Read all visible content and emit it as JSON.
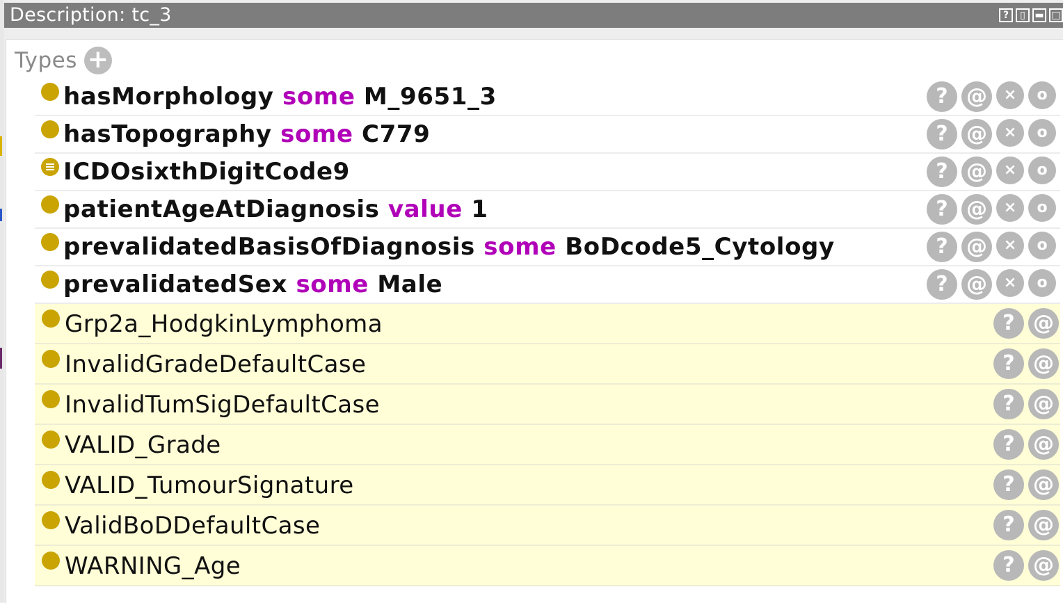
{
  "window": {
    "title": "Description: tc_3",
    "controls": [
      {
        "name": "help-icon",
        "glyph": "?"
      },
      {
        "name": "split-vertical-icon",
        "glyph": "▯"
      },
      {
        "name": "minimize-icon",
        "glyph": "▬"
      },
      {
        "name": "maximize-icon",
        "glyph": "□"
      }
    ]
  },
  "types": {
    "label": "Types",
    "add_glyph": "+",
    "asserted": [
      {
        "prop": "hasMorphology",
        "kw": "some",
        "filler": "M_9651_3",
        "dot": "class-icon"
      },
      {
        "prop": "hasTopography",
        "kw": "some",
        "filler": "C779",
        "dot": "class-icon"
      },
      {
        "prop": "ICDOsixthDigitCode9",
        "kw": "",
        "filler": "",
        "dot": "defined-class-icon"
      },
      {
        "prop": "patientAgeAtDiagnosis",
        "kw": "value",
        "filler": "1",
        "dot": "class-icon"
      },
      {
        "prop": "prevalidatedBasisOfDiagnosis",
        "kw": "some",
        "filler": "BoDcode5_Cytology",
        "dot": "class-icon"
      },
      {
        "prop": "prevalidatedSex",
        "kw": "some",
        "filler": "Male",
        "dot": "class-icon"
      }
    ],
    "inferred": [
      {
        "label": "Grp2a_HodgkinLymphoma"
      },
      {
        "label": "InvalidGradeDefaultCase"
      },
      {
        "label": "InvalidTumSigDefaultCase"
      },
      {
        "label": "VALID_Grade"
      },
      {
        "label": "VALID_TumourSignature"
      },
      {
        "label": "ValidBoDDefaultCase"
      },
      {
        "label": "WARNING_Age"
      }
    ],
    "button_glyphs": {
      "explain": "?",
      "annotate": "@",
      "delete": "×",
      "edit": "o"
    }
  },
  "colors": {
    "keyword": "#b000b8",
    "class_dot": "#c9a402",
    "inferred_bg": "#fffed7",
    "titlebar": "#7d7d7d"
  }
}
